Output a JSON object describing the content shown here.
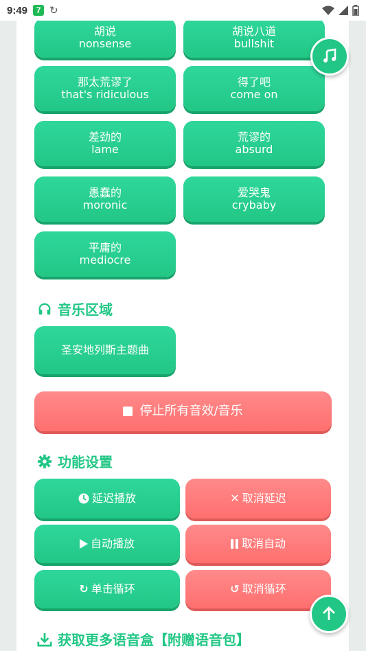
{
  "status_bar": {
    "time": "9:49",
    "app_badge": "7"
  },
  "phrase_buttons": [
    {
      "zh": "胡说",
      "en": "nonsense"
    },
    {
      "zh": "胡说八道",
      "en": "bullshit"
    },
    {
      "zh": "那太荒谬了",
      "en": "that's ridiculous"
    },
    {
      "zh": "得了吧",
      "en": "come on"
    },
    {
      "zh": "差劲的",
      "en": "lame"
    },
    {
      "zh": "荒谬的",
      "en": "absurd"
    },
    {
      "zh": "愚蠢的",
      "en": "moronic"
    },
    {
      "zh": "爱哭鬼",
      "en": "crybaby"
    },
    {
      "zh": "平庸的",
      "en": "mediocre"
    }
  ],
  "music_section": {
    "title": "音乐区域",
    "tracks": [
      "圣安地列斯主题曲"
    ]
  },
  "stop_all_label": "停止所有音效/音乐",
  "settings_section": {
    "title": "功能设置",
    "delay_play": "延迟播放",
    "cancel_delay": "取消延迟",
    "auto_play": "自动播放",
    "cancel_auto": "取消自动",
    "single_loop": "单击循环",
    "cancel_loop": "取消循环"
  },
  "download_section": {
    "title": "获取更多语音盒【附赠语音包】"
  },
  "colors": {
    "accent": "#22c785",
    "danger": "#ff6f6f"
  }
}
